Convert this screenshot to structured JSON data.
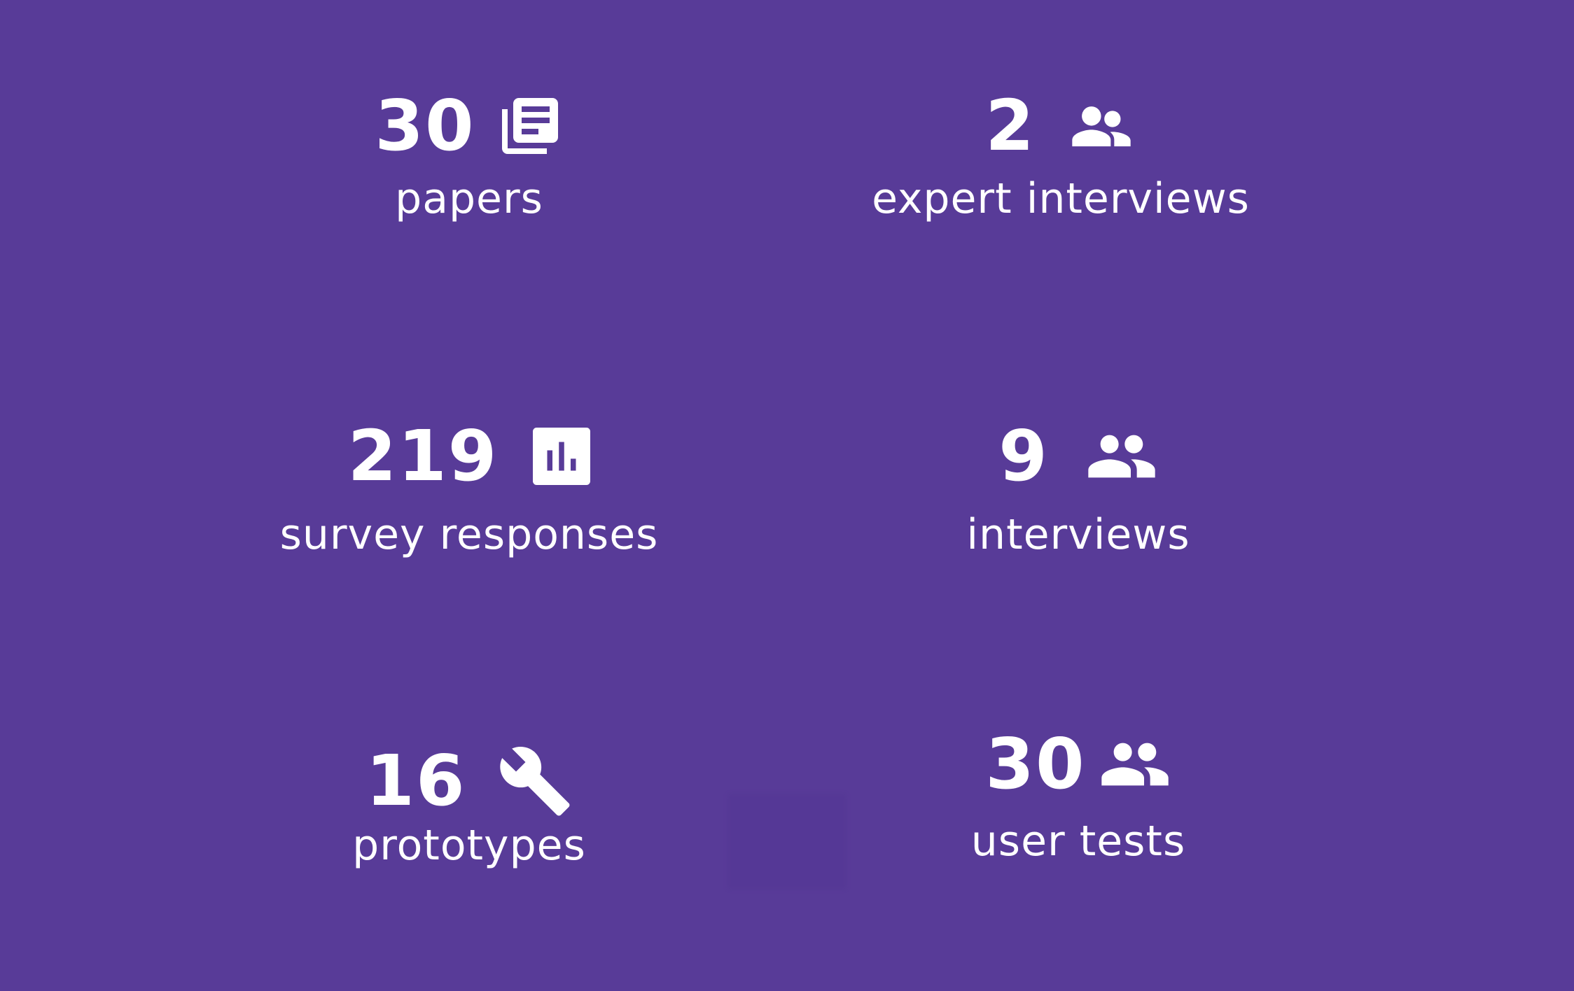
{
  "stats": [
    {
      "number": "30",
      "label": "papers",
      "icon": "papers-icon"
    },
    {
      "number": "2",
      "label": "expert interviews",
      "icon": "expert-people-icon"
    },
    {
      "number": "219",
      "label": "survey responses",
      "icon": "bar-chart-icon"
    },
    {
      "number": "9",
      "label": "interviews",
      "icon": "people-icon"
    },
    {
      "number": "16",
      "label": "prototypes",
      "icon": "wrench-icon"
    },
    {
      "number": "30",
      "label": "user tests",
      "icon": "people-icon"
    }
  ],
  "colors": {
    "background": "#583b98",
    "foreground": "#ffffff"
  }
}
